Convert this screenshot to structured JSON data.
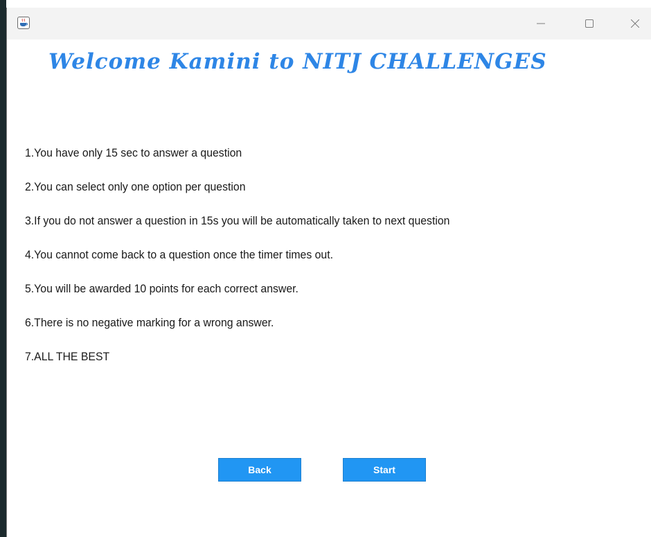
{
  "window": {
    "title_icon": "java-cup-icon",
    "controls": [
      "minimize-icon",
      "maximize-icon",
      "close-icon"
    ]
  },
  "welcome": "Welcome Kamini to NITJ CHALLENGES",
  "rules": [
    "1.You have only 15 sec to answer a question",
    "2.You can select only one option per question",
    "3.If you do not answer a question in 15s you will be automatically taken to next question",
    "4.You cannot come back to a question once the timer times out.",
    "5.You will be awarded 10 points for each correct answer.",
    "6.There is no negative marking for a wrong answer.",
    "7.ALL THE BEST"
  ],
  "buttons": {
    "back": "Back",
    "start": "Start"
  },
  "colors": {
    "accent": "#2196f3",
    "title": "#2e86e6"
  }
}
